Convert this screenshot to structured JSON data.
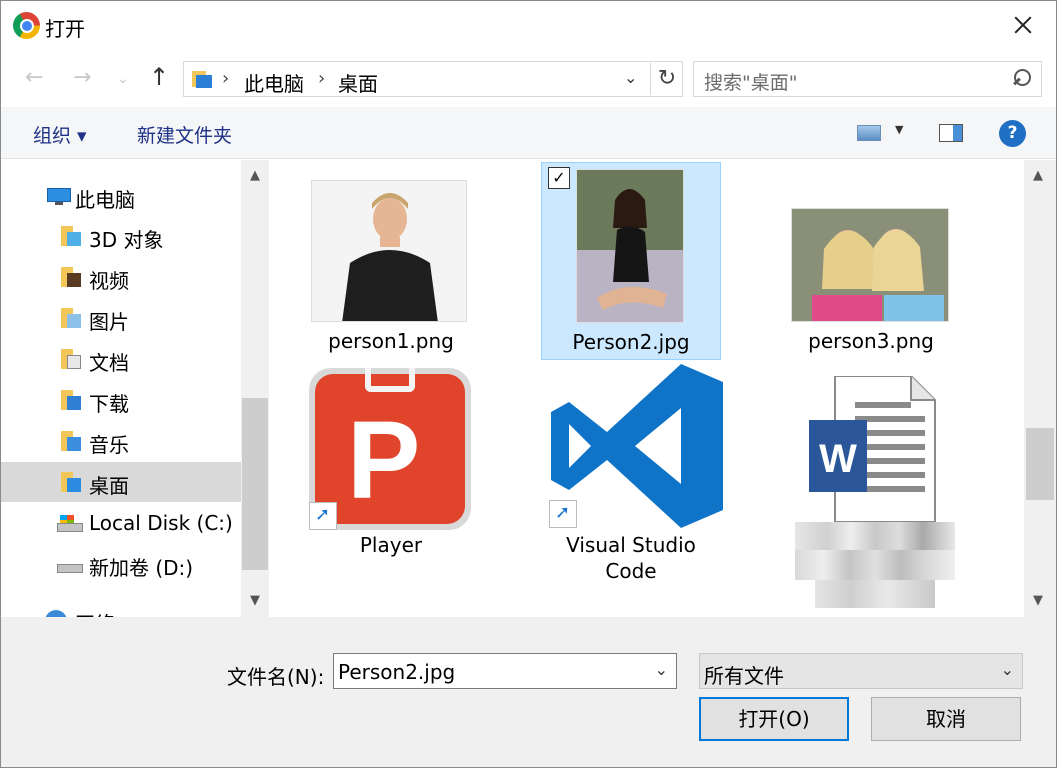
{
  "window": {
    "title": "打开"
  },
  "nav": {
    "back_icon": "back-arrow-icon",
    "forward_icon": "forward-arrow-icon",
    "up_icon": "up-arrow-icon",
    "breadcrumb": [
      "此电脑",
      "桌面"
    ],
    "search_placeholder": "搜索\"桌面\""
  },
  "toolbar": {
    "organize_label": "组织 ▾",
    "new_folder_label": "新建文件夹",
    "help_label": "?"
  },
  "sidebar": {
    "items": [
      {
        "label": "此电脑",
        "icon": "computer-icon"
      },
      {
        "label": "3D 对象",
        "icon": "folder-3d-icon"
      },
      {
        "label": "视频",
        "icon": "video-folder-icon"
      },
      {
        "label": "图片",
        "icon": "pictures-folder-icon"
      },
      {
        "label": "文档",
        "icon": "documents-folder-icon"
      },
      {
        "label": "下载",
        "icon": "downloads-folder-icon"
      },
      {
        "label": "音乐",
        "icon": "music-folder-icon"
      },
      {
        "label": "桌面",
        "icon": "desktop-folder-icon",
        "selected": true
      },
      {
        "label": "Local Disk (C:)",
        "icon": "local-disk-icon"
      },
      {
        "label": "新加卷 (D:)",
        "icon": "drive-icon"
      },
      {
        "label": "网络",
        "icon": "network-icon"
      }
    ]
  },
  "files": [
    {
      "name": "person1.png",
      "kind": "image"
    },
    {
      "name": "Person2.jpg",
      "kind": "image",
      "selected": true
    },
    {
      "name": "person3.png",
      "kind": "image"
    },
    {
      "name": "Player",
      "kind": "shortcut"
    },
    {
      "name": "Visual Studio Code",
      "name_line1": "Visual Studio",
      "name_line2": "Code",
      "kind": "shortcut"
    },
    {
      "name": "",
      "kind": "word-document"
    }
  ],
  "footer": {
    "filename_label": "文件名(N):",
    "filename_value": "Person2.jpg",
    "filetype_value": "所有文件",
    "open_label": "打开(O)",
    "cancel_label": "取消"
  },
  "colors": {
    "selection": "#cce8ff",
    "accent": "#0078d7",
    "link_text": "#1e3287"
  }
}
